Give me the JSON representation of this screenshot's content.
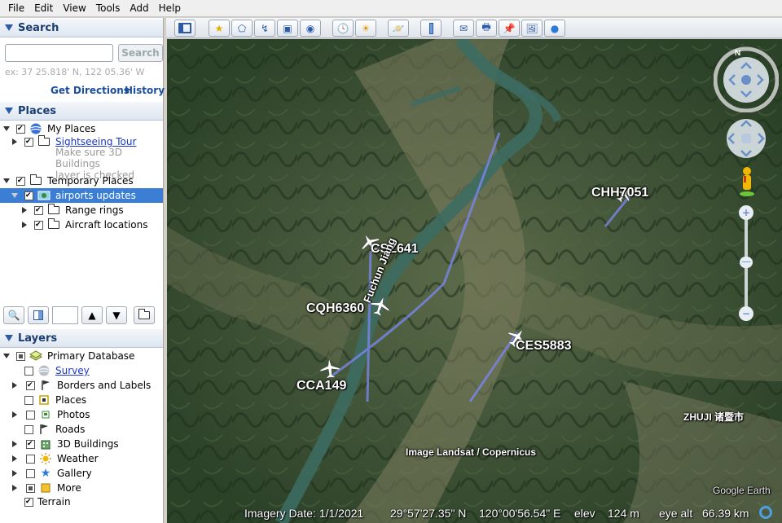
{
  "menu": [
    "File",
    "Edit",
    "View",
    "Tools",
    "Add",
    "Help"
  ],
  "search": {
    "title": "Search",
    "placeholder": "",
    "button": "Search",
    "hint": "ex: 37 25.818' N, 122 05.36' W",
    "get_directions": "Get Directions",
    "history": "History"
  },
  "places": {
    "title": "Places",
    "my_places": "My Places",
    "sightseeing_tour": "Sightseeing Tour",
    "tour_note": [
      "Make sure 3D Buildings",
      "layer is checked"
    ],
    "temporary_places": "Temporary Places",
    "airports_updates": "airports updates",
    "range_rings": "Range rings",
    "aircraft_locations": "Aircraft locations"
  },
  "layers": {
    "title": "Layers",
    "primary_database": "Primary Database",
    "survey": "Survey",
    "borders": "Borders and Labels",
    "places": "Places",
    "photos": "Photos",
    "roads": "Roads",
    "buildings": "3D Buildings",
    "weather": "Weather",
    "gallery": "Gallery",
    "more": "More",
    "terrain": "Terrain"
  },
  "map": {
    "flights": [
      "CSZ641",
      "CQH6360",
      "CCA149",
      "CES5883",
      "CHH7051"
    ],
    "river_label": "Fuchun Jiang",
    "city_label": "ZHUJI 诸暨市",
    "attribution": "Image Landsat / Copernicus",
    "watermark": "Google Earth",
    "compass_n": "N"
  },
  "status": {
    "imagery_date": "Imagery Date: 1/1/2021",
    "lat": "29°57'27.35\" N",
    "lon": "120°00'56.54\" E",
    "elev_label": "elev",
    "elev": "124 m",
    "eye_label": "eye alt",
    "eye": "66.39 km"
  },
  "colors": {
    "selected": "#3a7fd5",
    "section_text": "#1c3d72",
    "link": "#1a37c4",
    "track": "#7a86e8"
  }
}
